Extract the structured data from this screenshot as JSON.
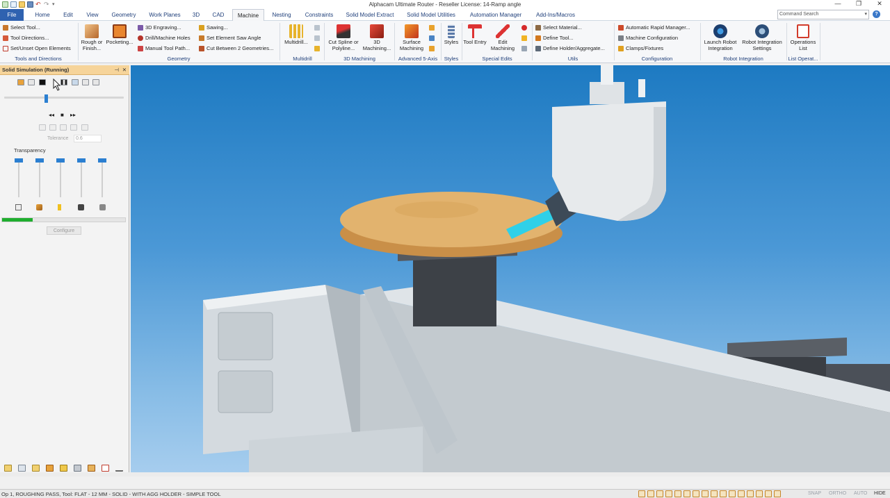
{
  "window": {
    "title": "Alphacam Ultimate Router - Reseller License: 14-Ramp angle",
    "controls": [
      "—",
      "❐",
      "✕"
    ]
  },
  "tabs": [
    {
      "label": "File",
      "w": 0
    },
    {
      "label": "Home"
    },
    {
      "label": "Edit"
    },
    {
      "label": "View"
    },
    {
      "label": "Geometry"
    },
    {
      "label": "Work Planes"
    },
    {
      "label": "3D"
    },
    {
      "label": "CAD"
    },
    {
      "label": "Machine"
    },
    {
      "label": "Nesting"
    },
    {
      "label": "Constraints"
    },
    {
      "label": "Solid Model Extract"
    },
    {
      "label": "Solid Model Utilities"
    },
    {
      "label": "Automation Manager"
    },
    {
      "label": "Add-Ins/Macros"
    }
  ],
  "active_tab": "Machine",
  "command_search": {
    "placeholder": "Command Search",
    "help": "?"
  },
  "ribbon": {
    "tools_dirs": {
      "items": [
        "Select Tool...",
        "Tool Directions...",
        "Set/Unset Open Elements"
      ],
      "label": "Tools and Directions"
    },
    "geometry": {
      "rough": "Rough or Finish...",
      "pocketing": "Pocketing...",
      "items": [
        "3D Engraving...",
        "Drill/Machine Holes",
        "Manual Tool Path..."
      ],
      "items2": [
        "Sawing...",
        "Set Element Saw Angle",
        "Cut Between 2 Geometries..."
      ],
      "label": "Geometry"
    },
    "multidrill": {
      "button": "Multidrill...",
      "label": "Multidrill"
    },
    "machining3d": {
      "cut_spline": "Cut Spline or Polyline...",
      "machining": "3D Machining...",
      "label": "3D Machining"
    },
    "adv5": {
      "surface": "Surface Machining",
      "label": "Advanced 5-Axis"
    },
    "styles": {
      "button": "Styles",
      "label": "Styles"
    },
    "special": {
      "tool_entry": "Tool Entry",
      "edit_machining": "Edit Machining",
      "label": "Special Edits"
    },
    "utils": {
      "items": [
        "Select Material...",
        "Define Tool...",
        "Define Holder/Aggregate..."
      ],
      "label": "Utils"
    },
    "config": {
      "items": [
        "Automatic Rapid Manager...",
        "Machine Configuration",
        "Clamps/Fixtures"
      ],
      "label": "Configuration"
    },
    "robot": {
      "launch": "Launch Robot Integration",
      "settings": "Robot Integration Settings",
      "label": "Robot Integration"
    },
    "listops": {
      "button": "Operations List",
      "label": "List Operat..."
    }
  },
  "panel": {
    "title": "Solid Simulation (Running)",
    "pin": "⊣",
    "close": "✕",
    "tolerance_label": "Tolerance",
    "tolerance_value": "0.6",
    "transparency_label": "Transparency",
    "progress_fraction": 0.25,
    "configure": "Configure",
    "playback": {
      "rewind": "◂◂",
      "stop": "■",
      "forward": "▸▸"
    }
  },
  "status": {
    "text": "Op 1, ROUGHING PASS, Tool: FLAT - 12 MM - SOLID - WITH AGG HOLDER - SIMPLE TOOL",
    "snap": "SNAP",
    "ortho": "ORTHO",
    "auto": "AUTO",
    "hide": "HIDE"
  },
  "colors": {
    "accent": "#2f62b0",
    "panel_title": "#f6d49a",
    "progress": "#1fae2e",
    "sky_top": "#1d7ac2",
    "sky_bottom": "#a6cdee",
    "cutter": "#2fd0e8",
    "wood": "#d9a55c"
  },
  "icons": [
    "new-icon",
    "open-icon",
    "save-icon",
    "undo-icon",
    "redo-icon",
    "search-icon",
    "help-icon",
    "pin-icon",
    "close-icon",
    "cursor-icon"
  ]
}
